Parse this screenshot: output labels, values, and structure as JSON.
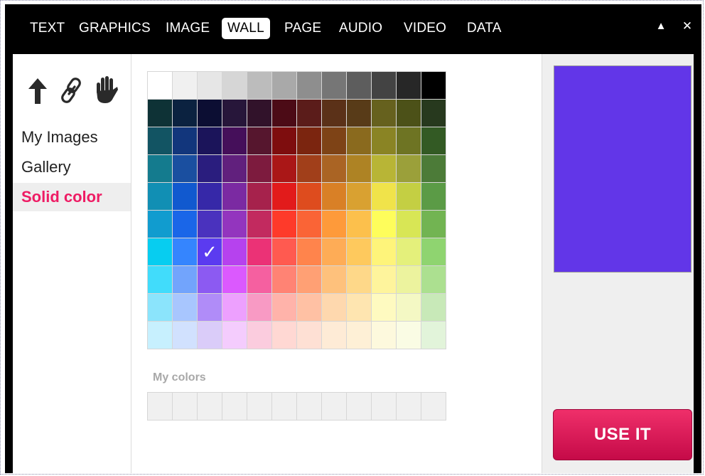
{
  "topnav": {
    "tabs": [
      {
        "label": "TEXT"
      },
      {
        "label": "GRAPHICS"
      },
      {
        "label": "IMAGE"
      },
      {
        "label": "WALL",
        "active": true
      },
      {
        "label": "PAGE"
      },
      {
        "label": "AUDIO"
      },
      {
        "label": "VIDEO"
      },
      {
        "label": "DATA"
      }
    ],
    "collapse_glyph": "▲",
    "close_glyph": "✕"
  },
  "sidebar": {
    "tools": [
      {
        "icon": "up-arrow-icon",
        "glyph": "🡅"
      },
      {
        "icon": "link-icon",
        "glyph": "🔗"
      },
      {
        "icon": "hand-icon",
        "glyph": "✋"
      }
    ],
    "items": [
      {
        "label": "My Images"
      },
      {
        "label": "Gallery"
      },
      {
        "label": "Solid color",
        "active": true
      }
    ]
  },
  "palette": {
    "selected": "#5B3BF0",
    "check_glyph": "✓",
    "rows": [
      [
        "#FFFFFF",
        "#F0F0F0",
        "#E6E6E6",
        "#D6D6D6",
        "#BCBCBC",
        "#A9A9A9",
        "#8E8E8E",
        "#767676",
        "#5D5D5D",
        "#434343",
        "#272727",
        "#000000"
      ],
      [
        "#0E3236",
        "#0B2240",
        "#0C0E33",
        "#27163A",
        "#31122A",
        "#4C0B16",
        "#5B1C1A",
        "#5B3118",
        "#583B18",
        "#66611E",
        "#4C5118",
        "#27391E"
      ],
      [
        "#125463",
        "#12367C",
        "#1B145A",
        "#450F5A",
        "#56162E",
        "#7E0D0E",
        "#7B250F",
        "#7E4316",
        "#8A6A1E",
        "#8A8424",
        "#6E7423",
        "#335A24"
      ],
      [
        "#147B8E",
        "#1A4FA0",
        "#2A1D7E",
        "#61207D",
        "#7D1B3E",
        "#AA1717",
        "#A13F1A",
        "#AA6424",
        "#AE8324",
        "#B8B536",
        "#9BA03A",
        "#4C7B38"
      ],
      [
        "#118FB4",
        "#1159CF",
        "#3628A8",
        "#7B2AA2",
        "#A6224C",
        "#E21B1B",
        "#DE4C1E",
        "#D98026",
        "#D9A131",
        "#F0E34A",
        "#C4CF43",
        "#5B9B46"
      ],
      [
        "#119CCF",
        "#1A66E8",
        "#4A32BE",
        "#9335BE",
        "#C22A5F",
        "#FE3A2A",
        "#FA6436",
        "#FE9A3A",
        "#FCC04C",
        "#FEFD5B",
        "#D8E655",
        "#72B452"
      ],
      [
        "#07CDF0",
        "#3585FE",
        "#5B3BF0",
        "#B642EE",
        "#EB3276",
        "#FF5A50",
        "#FF844C",
        "#FEAC56",
        "#FEC95D",
        "#FEF47A",
        "#E4F07B",
        "#8FD470"
      ],
      [
        "#41DCFB",
        "#72A4FC",
        "#8C5AF2",
        "#DB59FE",
        "#F560A0",
        "#FF8374",
        "#FFA074",
        "#FEC17C",
        "#FED889",
        "#FEF49C",
        "#ECF39E",
        "#ACE090"
      ],
      [
        "#8BE4FC",
        "#A8C6FE",
        "#B08CF8",
        "#EDA0FE",
        "#F89AC4",
        "#FFB3AA",
        "#FFC1A4",
        "#FED8AE",
        "#FEE5B0",
        "#FEFAC0",
        "#F4F8C4",
        "#C8E9B8"
      ],
      [
        "#C7F0FE",
        "#D1E1FE",
        "#DACCF9",
        "#F4CCFD",
        "#FBCCDE",
        "#FFD8D3",
        "#FEE0D4",
        "#FEEBD6",
        "#FEF0D6",
        "#FDF9DD",
        "#FAFCE4",
        "#E2F4DA"
      ]
    ]
  },
  "my_colors": {
    "label": "My colors",
    "slots": 12
  },
  "preview": {
    "color": "#6236E8"
  },
  "use_button": {
    "label": "USE IT"
  }
}
